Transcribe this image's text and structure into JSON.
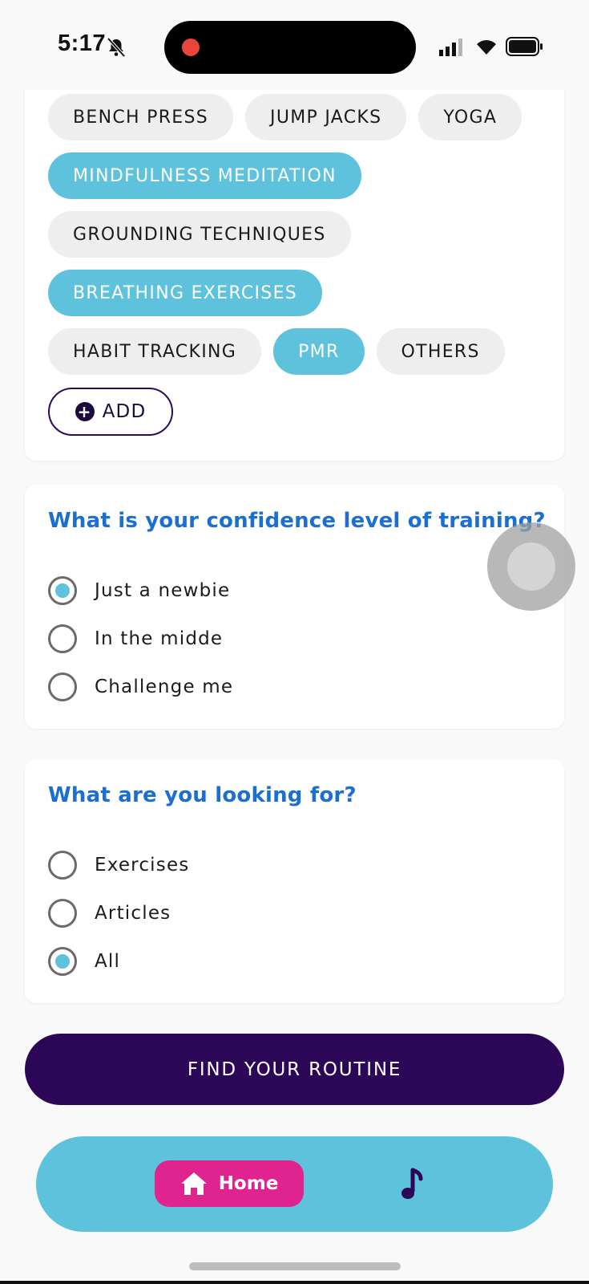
{
  "status_bar": {
    "time": "5:17"
  },
  "activities": {
    "chips": [
      {
        "label": "BENCH PRESS",
        "selected": false
      },
      {
        "label": "JUMP JACKS",
        "selected": false
      },
      {
        "label": "YOGA",
        "selected": false
      },
      {
        "label": "MINDFULNESS MEDITATION",
        "selected": true
      },
      {
        "label": "GROUNDING TECHNIQUES",
        "selected": false
      },
      {
        "label": "BREATHING EXERCISES",
        "selected": true
      },
      {
        "label": "HABIT TRACKING",
        "selected": false
      },
      {
        "label": "PMR",
        "selected": true
      },
      {
        "label": "OTHERS",
        "selected": false
      }
    ],
    "add_label": "ADD"
  },
  "confidence": {
    "question": "What is your confidence level of training?",
    "options": [
      {
        "label": "Just a newbie",
        "checked": true
      },
      {
        "label": "In the midde",
        "checked": false
      },
      {
        "label": "Challenge me",
        "checked": false
      }
    ]
  },
  "looking_for": {
    "question": "What are you looking for?",
    "options": [
      {
        "label": "Exercises",
        "checked": false
      },
      {
        "label": "Articles",
        "checked": false
      },
      {
        "label": "All",
        "checked": true
      }
    ]
  },
  "find_button_label": "FIND YOUR ROUTINE",
  "bottom_nav": {
    "home_label": "Home",
    "home_icon": "home-icon",
    "music_icon": "music-note-icon"
  },
  "colors": {
    "accent": "#5fc2dc",
    "primary_dark": "#2c0757",
    "question_blue": "#1a6fd0",
    "home_pink": "#e0248f"
  }
}
